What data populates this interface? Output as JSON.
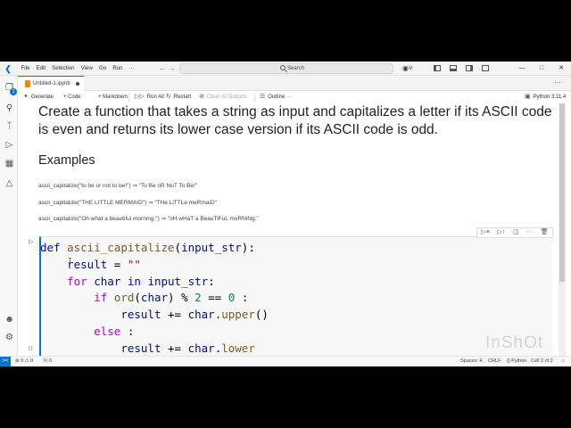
{
  "menu": [
    "File",
    "Edit",
    "Selection",
    "View",
    "Go",
    "Run",
    "···"
  ],
  "titlebar": {
    "search_label": "Search",
    "back": "←",
    "forward": "→",
    "copilot_icon": "copilot-icon",
    "minimize": "—",
    "maximize": "□",
    "close": "✕"
  },
  "activity": {
    "explorer_badge": "1",
    "icons": [
      "files-icon",
      "search-icon",
      "source-control-icon",
      "run-debug-icon",
      "extensions-icon",
      "testing-icon",
      "account-icon",
      "settings-icon"
    ]
  },
  "tab": {
    "label": "Untitled-1.ipynb",
    "more": "···"
  },
  "toolbar": {
    "generate": "Generate",
    "code": "+ Code",
    "markdown": "+ Markdown",
    "run_all": "Run All",
    "restart": "Restart",
    "clear_outputs": "Clear All Outputs",
    "outline": "Outline",
    "more": "···",
    "kernel": "Python 3.11.4"
  },
  "markdown": {
    "question": "Create a function that takes a string as input and capitalizes a letter if its ASCII code is even and returns its lower case version if its ASCII code is odd.",
    "heading": "Examples",
    "examples": [
      "ascii_capitalize(\"to be or not to be!\") ➞ \"To Be oR NoT To Be!\"",
      "ascii_capitalize(\"THE LITTLE MERMAID\") ➞ \"THe LiTTLe meRmaiD\"",
      "ascii_capitalize(\"Oh what a beautiful morning.\") ➞ \"oH wHaT a BeauTiFuL moRNiNg.\""
    ]
  },
  "code_cell": {
    "lines": [
      "def ascii_capitalize(input_str):",
      "    result = \"\"",
      "    for char in input_str:",
      "        if ord(char) % 2 == 0 :",
      "            result += char.upper()",
      "        else :",
      "            result += char.lower"
    ],
    "status_mark": "[ ]",
    "cursor": "I"
  },
  "watermark": "InShOt",
  "statusbar": {
    "remote": "><",
    "problems": "⊗ 0 ⚠ 0",
    "ports": "ⓦ 0",
    "spaces": "Spaces: 4",
    "eol": "CRLF",
    "language": "{} Python",
    "cell": "Cell 2 of 2",
    "bell": "♪"
  },
  "colors": {
    "accent": "#0b73c9",
    "keyword": "#0000ff",
    "control": "#af00db",
    "function": "#795e26",
    "string": "#a31515",
    "number": "#098658"
  }
}
